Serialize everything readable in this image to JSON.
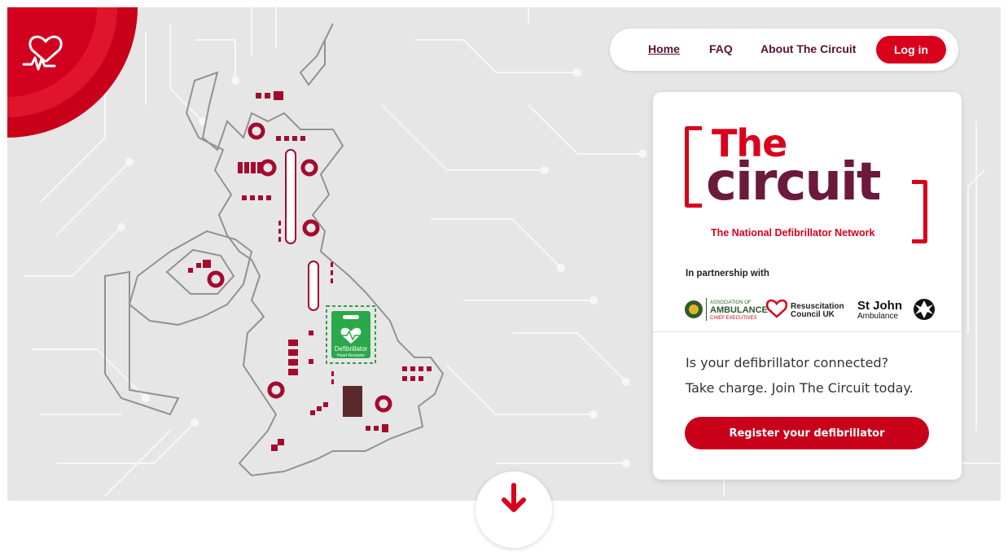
{
  "brand": {
    "accent": "#d9001b",
    "plum": "#6b1a3c",
    "logo_icon": "heart-pulse-icon"
  },
  "nav": {
    "home": "Home",
    "faq": "FAQ",
    "about": "About The Circuit",
    "login": "Log in"
  },
  "card": {
    "logo_the": "The",
    "logo_circuit": "circuit",
    "logo_subtitle": "The National Defibrillator Network",
    "partnership": "In partnership with",
    "partners": {
      "aace_line1": "ASSOCIATION OF",
      "aace_line2": "AMBULANCE",
      "aace_line3": "CHIEF EXECUTIVES",
      "rc_line1": "Resuscitation",
      "rc_line2": "Council UK",
      "sja_line1": "St John",
      "sja_line2": "Ambulance"
    },
    "question": "Is your defibrillator connected?",
    "cta_text": "Take charge. Join The Circuit today.",
    "register_button": "Register your defibrillator"
  },
  "map": {
    "chip_label": "Defibrillator",
    "chip_sublabel": "Heart Restarter"
  },
  "scroll": {
    "icon": "arrow-down-icon"
  }
}
